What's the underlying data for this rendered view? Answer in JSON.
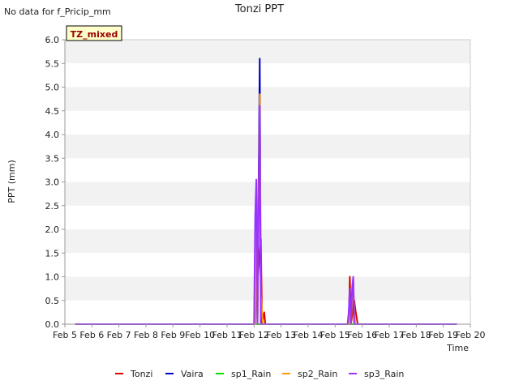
{
  "header": {
    "no_data_note": "No data for f_Pricip_mm",
    "badge": "TZ_mixed"
  },
  "chart_data": {
    "type": "line",
    "title": "Tonzi PPT",
    "xlabel": "Time",
    "ylabel": "PPT (mm)",
    "xlim": [
      "2024-02-05",
      "2024-02-20"
    ],
    "ylim": [
      0,
      6.0
    ],
    "yticks": [
      0.0,
      0.5,
      1.0,
      1.5,
      2.0,
      2.5,
      3.0,
      3.5,
      4.0,
      4.5,
      5.0,
      5.5,
      6.0
    ],
    "xtick_labels": [
      "Feb 5",
      "Feb 6",
      "Feb 7",
      "Feb 8",
      "Feb 9",
      "Feb 10",
      "Feb 11",
      "Feb 12",
      "Feb 13",
      "Feb 14",
      "Feb 15",
      "Feb 16",
      "Feb 17",
      "Feb 18",
      "Feb 19",
      "Feb 20"
    ],
    "grid": "horizontal bands",
    "legend_position": "bottom",
    "series": [
      {
        "name": "Tonzi",
        "color": "#dd0000",
        "points": [
          [
            "2024-02-05 09:00",
            0
          ],
          [
            "2024-02-12 00:00",
            0
          ],
          [
            "2024-02-12 06:00",
            1.8
          ],
          [
            "2024-02-12 07:00",
            0
          ],
          [
            "2024-02-12 09:00",
            0.25
          ],
          [
            "2024-02-12 10:00",
            0
          ],
          [
            "2024-02-15 12:00",
            0
          ],
          [
            "2024-02-15 13:00",
            1.0
          ],
          [
            "2024-02-15 14:00",
            0
          ],
          [
            "2024-02-15 17:00",
            0.5
          ],
          [
            "2024-02-15 18:00",
            0.3
          ],
          [
            "2024-02-15 20:00",
            0
          ],
          [
            "2024-02-19 12:00",
            0
          ]
        ]
      },
      {
        "name": "Vaira",
        "color": "#0000cc",
        "points": [
          [
            "2024-02-05 09:00",
            0
          ],
          [
            "2024-02-12 01:00",
            0
          ],
          [
            "2024-02-12 02:00",
            1.5
          ],
          [
            "2024-02-12 03:00",
            0
          ],
          [
            "2024-02-12 04:00",
            3.0
          ],
          [
            "2024-02-12 05:00",
            5.6
          ],
          [
            "2024-02-12 06:00",
            0
          ],
          [
            "2024-02-15 12:00",
            0
          ],
          [
            "2024-02-15 13:00",
            0.75
          ],
          [
            "2024-02-15 14:00",
            0
          ],
          [
            "2024-02-15 15:00",
            0.5
          ],
          [
            "2024-02-15 16:00",
            0.75
          ],
          [
            "2024-02-15 17:00",
            0
          ],
          [
            "2024-02-19 12:00",
            0
          ]
        ]
      },
      {
        "name": "sp1_Rain",
        "color": "#00dd00",
        "points": [
          [
            "2024-02-05 09:00",
            0
          ],
          [
            "2024-02-19 12:00",
            0
          ]
        ]
      },
      {
        "name": "sp2_Rain",
        "color": "#ff9900",
        "points": [
          [
            "2024-02-05 09:00",
            0
          ],
          [
            "2024-02-12 01:00",
            0
          ],
          [
            "2024-02-12 02:00",
            2.0
          ],
          [
            "2024-02-12 03:00",
            0
          ],
          [
            "2024-02-12 04:00",
            2.5
          ],
          [
            "2024-02-12 05:00",
            4.85
          ],
          [
            "2024-02-12 06:00",
            0.6
          ],
          [
            "2024-02-12 07:00",
            0.25
          ],
          [
            "2024-02-12 08:00",
            0
          ],
          [
            "2024-02-15 12:00",
            0
          ],
          [
            "2024-02-15 13:00",
            0.55
          ],
          [
            "2024-02-15 14:00",
            0
          ],
          [
            "2024-02-15 15:00",
            0.45
          ],
          [
            "2024-02-15 16:00",
            0.95
          ],
          [
            "2024-02-15 17:00",
            0.25
          ],
          [
            "2024-02-15 18:00",
            0
          ],
          [
            "2024-02-19 12:00",
            0
          ]
        ]
      },
      {
        "name": "sp3_Rain",
        "color": "#9933ff",
        "points": [
          [
            "2024-02-05 09:00",
            0
          ],
          [
            "2024-02-12 00:00",
            0
          ],
          [
            "2024-02-12 01:00",
            2.3
          ],
          [
            "2024-02-12 02:00",
            3.05
          ],
          [
            "2024-02-12 03:00",
            0
          ],
          [
            "2024-02-12 04:00",
            2.3
          ],
          [
            "2024-02-12 05:00",
            4.6
          ],
          [
            "2024-02-12 06:00",
            0
          ],
          [
            "2024-02-15 11:00",
            0
          ],
          [
            "2024-02-15 12:00",
            0.25
          ],
          [
            "2024-02-15 13:00",
            0.75
          ],
          [
            "2024-02-15 14:00",
            0
          ],
          [
            "2024-02-15 15:00",
            0.75
          ],
          [
            "2024-02-15 16:00",
            1.0
          ],
          [
            "2024-02-15 17:00",
            0
          ],
          [
            "2024-02-19 12:00",
            0
          ]
        ]
      }
    ]
  }
}
